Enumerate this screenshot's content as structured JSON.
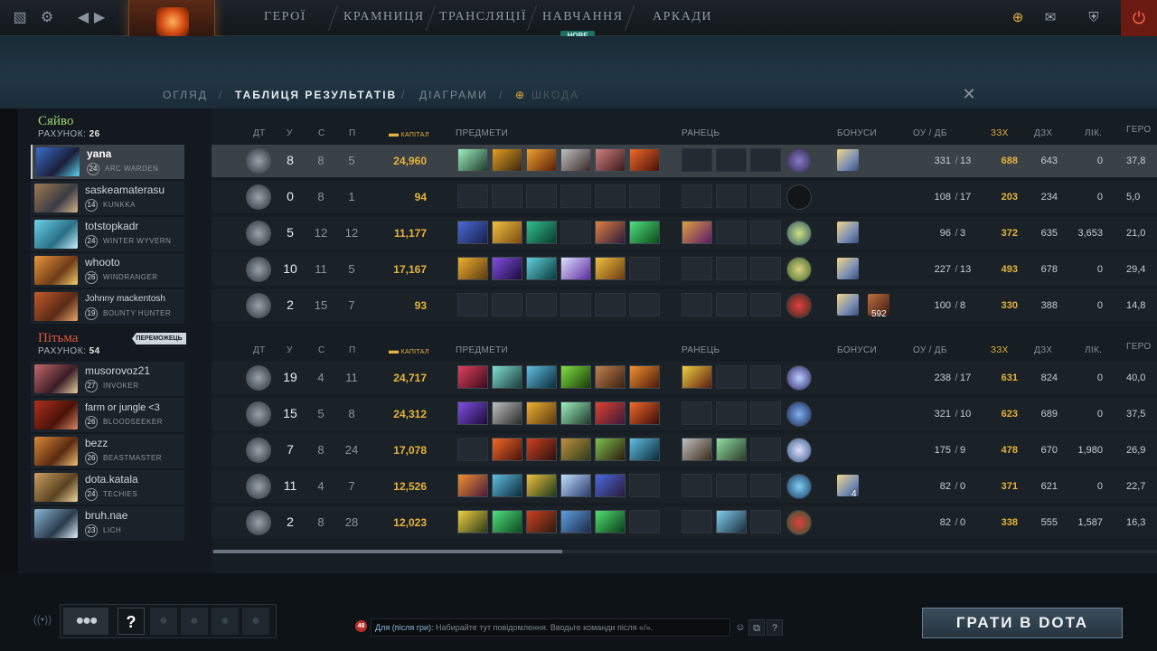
{
  "topbar": {
    "nav": [
      "ГЕРОЇ",
      "КРАМНИЦЯ",
      "ТРАНСЛЯЦІЇ",
      "НАВЧАННЯ",
      "АРКАДИ"
    ],
    "new_badge": "НОВЕ",
    "icons": [
      "dota-logo-icon",
      "settings-icon",
      "back-icon",
      "forward-icon",
      "plus-coin-icon",
      "mail-icon",
      "armory-icon",
      "power-icon"
    ]
  },
  "subtabs": {
    "overview": "ОГЛЯД",
    "scoreboard": "ТАБЛИЦЯ РЕЗУЛЬТАТІВ",
    "graphs": "ДІАГРАМИ",
    "damage": "ШКОДА",
    "sep": "/"
  },
  "headers": {
    "lvl": "ДТ",
    "k": "У",
    "d": "С",
    "a": "П",
    "networth": "КАПІТАЛ",
    "items": "ПРЕДМЕТИ",
    "backpack": "РАНЕЦЬ",
    "buffs": "БОНУСИ",
    "lh": "ОУ",
    "lh_sep": "/",
    "dn": "ДБ",
    "gpm": "ЗЗХ",
    "xpm": "ДЗХ",
    "heal": "ЛІК.",
    "hd": "ГЕРО"
  },
  "radiant": {
    "name": "Сяйво",
    "score_label": "РАХУНОК:",
    "score": "26",
    "players": [
      {
        "name": "yana",
        "level": "24",
        "hero": "ARC WARDEN",
        "k": "8",
        "d": "8",
        "a": "5",
        "nw": "24,960",
        "lh": "331",
        "dn": "13",
        "gpm": "688",
        "xpm": "643",
        "heal": "0",
        "hd": "37,8"
      },
      {
        "name": "saskeamaterasu",
        "level": "14",
        "hero": "KUNKKA",
        "k": "0",
        "d": "8",
        "a": "1",
        "nw": "94",
        "lh": "108",
        "dn": "17",
        "gpm": "203",
        "xpm": "234",
        "heal": "0",
        "hd": "5,0"
      },
      {
        "name": "totstopkadr",
        "level": "24",
        "hero": "WINTER WYVERN",
        "k": "5",
        "d": "12",
        "a": "12",
        "nw": "11,177",
        "lh": "96",
        "dn": "3",
        "gpm": "372",
        "xpm": "635",
        "heal": "3,653",
        "hd": "21,0"
      },
      {
        "name": "whooto",
        "level": "26",
        "hero": "WINDRANGER",
        "k": "10",
        "d": "11",
        "a": "5",
        "nw": "17,167",
        "lh": "227",
        "dn": "13",
        "gpm": "493",
        "xpm": "678",
        "heal": "0",
        "hd": "29,4"
      },
      {
        "name": "Johnny mackentosh",
        "level": "19",
        "hero": "BOUNTY HUNTER",
        "k": "2",
        "d": "15",
        "a": "7",
        "nw": "93",
        "lh": "100",
        "dn": "8",
        "gpm": "330",
        "xpm": "388",
        "heal": "0",
        "hd": "14,8"
      }
    ]
  },
  "dire": {
    "name": "Пітьма",
    "score_label": "РАХУНОК:",
    "score": "54",
    "winner": "ПЕРЕМОЖЕЦЬ",
    "players": [
      {
        "name": "musorovoz21",
        "level": "27",
        "hero": "INVOKER",
        "k": "19",
        "d": "4",
        "a": "11",
        "nw": "24,717",
        "lh": "238",
        "dn": "17",
        "gpm": "631",
        "xpm": "824",
        "heal": "0",
        "hd": "40,0"
      },
      {
        "name": "farm or jungle <3",
        "level": "26",
        "hero": "BLOODSEEKER",
        "k": "15",
        "d": "5",
        "a": "8",
        "nw": "24,312",
        "lh": "321",
        "dn": "10",
        "gpm": "623",
        "xpm": "689",
        "heal": "0",
        "hd": "37,5"
      },
      {
        "name": "bezz",
        "level": "26",
        "hero": "BEASTMASTER",
        "k": "7",
        "d": "8",
        "a": "24",
        "nw": "17,078",
        "lh": "175",
        "dn": "9",
        "gpm": "478",
        "xpm": "670",
        "heal": "1,980",
        "hd": "26,9"
      },
      {
        "name": "dota.katala",
        "level": "24",
        "hero": "TECHIES",
        "k": "11",
        "d": "4",
        "a": "7",
        "nw": "12,526",
        "lh": "82",
        "dn": "0",
        "gpm": "371",
        "xpm": "621",
        "heal": "0",
        "hd": "22,7"
      },
      {
        "name": "bruh.nae",
        "level": "23",
        "hero": "LICH",
        "k": "2",
        "d": "8",
        "a": "28",
        "nw": "12,023",
        "lh": "82",
        "dn": "0",
        "gpm": "338",
        "xpm": "555",
        "heal": "1,587",
        "hd": "16,3"
      }
    ]
  },
  "buff_count": "592",
  "buff_count_small": "4",
  "bottom": {
    "help": "?",
    "chat_unread": "48",
    "chat_target": "Для (після гри):",
    "chat_placeholder": "Набирайте тут повідомлення. Вводьте команди після «/».",
    "chat_help": "?",
    "play": "ГРАТИ В DOTA"
  },
  "colors": {
    "radiant": "#9bd46e",
    "dire": "#e3553e",
    "gold": "#e5b33d"
  }
}
